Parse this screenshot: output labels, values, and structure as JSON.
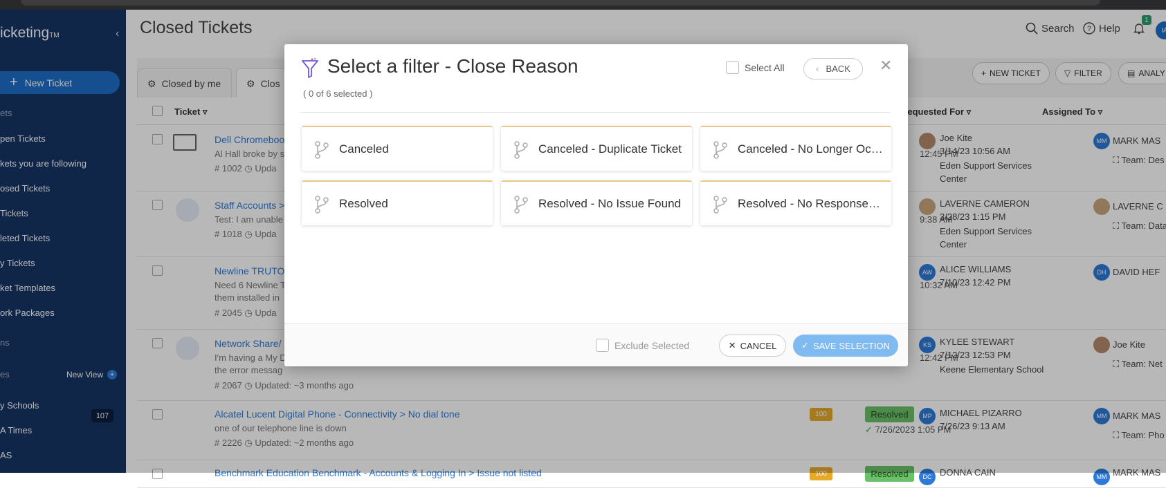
{
  "app": {
    "brand": "icketing",
    "brand_tm": "TM",
    "page_title": "Closed Tickets",
    "search_label": "Search",
    "help_label": "Help",
    "notification_count": "1",
    "user_initials": "IA"
  },
  "sidebar": {
    "new_ticket_label": "New Ticket",
    "section_tickets": "ets",
    "items": [
      "pen Tickets",
      "kets you are following",
      "osed Tickets",
      " Tickets",
      "leted Tickets",
      "y Tickets",
      "ket Templates",
      "ork Packages"
    ],
    "section_actions": "ns",
    "section_views": "es",
    "new_view_label": "New View",
    "views": [
      "y Schools",
      "A Times",
      "AS"
    ],
    "views_count": "107"
  },
  "tabs": [
    "Closed by me",
    "Clos"
  ],
  "actions": {
    "new_ticket": "NEW TICKET",
    "filter": "FILTER",
    "analyze": "ANALY"
  },
  "columns": {
    "ticket": "Ticket",
    "requested_for": "Requested For",
    "assigned_to": "Assigned To"
  },
  "rows": [
    {
      "title": "Dell Chromebook",
      "desc": [
        "Al Hall broke by s"
      ],
      "number": "# 1002",
      "updated": "Upda",
      "time": "12:45 PM",
      "req_name": "Joe Kite",
      "req_date": "3/14/23 10:56 AM",
      "req_loc": [
        "Eden Support Services",
        "Center"
      ],
      "asg_initials": "MM",
      "asg_name": "MARK MAS",
      "asg_team": "Team: Des"
    },
    {
      "title": "Staff Accounts >",
      "desc": [
        "Test: I am unable"
      ],
      "number": "# 1018",
      "updated": "Upda",
      "time": "9:38 AM",
      "req_name": "LAVERNE CAMERON",
      "req_date": "3/28/23 1:15 PM",
      "req_loc": [
        "Eden Support Services",
        "Center"
      ],
      "asg_name": "LAVERNE C",
      "asg_team": "Team: Data"
    },
    {
      "title": "Newline TRUTO",
      "desc": [
        "Need 6 Newline T",
        "them installed in"
      ],
      "number": "# 2045",
      "updated": "Upda",
      "time": "10:32 AM",
      "req_initials": "AW",
      "req_name": "ALICE WILLIAMS",
      "req_date": "7/10/23 12:42 PM",
      "asg_initials": "DH",
      "asg_name": "DAVID HEF"
    },
    {
      "title": "Network Share/",
      "desc": [
        "I'm having a My D",
        "the error messag"
      ],
      "number": "# 2067",
      "updated": "Updated: ~3 months ago",
      "time": "12:42 PM",
      "req_initials": "KS",
      "req_name": "KYLEE STEWART",
      "req_date": "7/12/23 12:53 PM",
      "req_loc": [
        "Keene Elementary School"
      ],
      "asg_name": "Joe Kite",
      "asg_team": "Team: Net"
    },
    {
      "title": "Alcatel Lucent Digital Phone - Connectivity > No dial tone",
      "desc": [
        "one of our telephone line is down"
      ],
      "number": "# 2226",
      "updated": "Updated: ~2 months ago",
      "priority": "100",
      "status": "Resolved",
      "status_date": "7/26/2023 1:05 PM",
      "req_initials": "MP",
      "req_name": "MICHAEL PIZARRO",
      "req_date": "7/26/23 9:13 AM",
      "asg_initials": "MM",
      "asg_name": "MARK MAS",
      "asg_team": "Team: Pho"
    },
    {
      "title": "Benchmark Education Benchmark - Accounts & Logging In > Issue not listed",
      "priority": "100",
      "status": "Resolved",
      "req_initials": "DC",
      "req_name": "DONNA CAIN",
      "asg_initials": "MM",
      "asg_name": "MARK MAS"
    }
  ],
  "modal": {
    "title": "Select a filter - Close Reason",
    "subtitle": "( 0 of 6 selected )",
    "select_all": "Select All",
    "back": "BACK",
    "options": [
      "Canceled",
      "Canceled - Duplicate Ticket",
      "Canceled - No Longer Occ...",
      "Resolved",
      "Resolved - No Issue Found",
      "Resolved - No Response F..."
    ],
    "exclude_selected": "Exclude Selected",
    "cancel": "CANCEL",
    "save": "SAVE SELECTION"
  }
}
